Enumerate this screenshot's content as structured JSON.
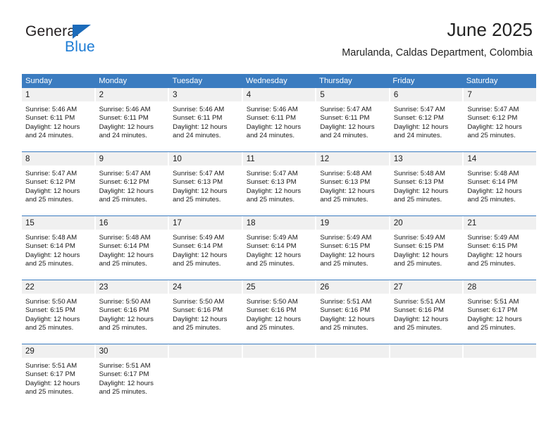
{
  "brand": {
    "name_part1": "General",
    "name_part2": "Blue",
    "triangle_icon": "blue-triangle-icon",
    "color_dark": "#231f20",
    "color_blue": "#1c7bd4"
  },
  "header": {
    "title": "June 2025",
    "subtitle": "Marulanda, Caldas Department, Colombia"
  },
  "theme": {
    "header_bar": "#3b7cc0",
    "day_band": "#f0f0f0",
    "text": "#1a1a1a"
  },
  "weekdays": [
    "Sunday",
    "Monday",
    "Tuesday",
    "Wednesday",
    "Thursday",
    "Friday",
    "Saturday"
  ],
  "weeks": [
    [
      {
        "day": "1",
        "sunrise": "Sunrise: 5:46 AM",
        "sunset": "Sunset: 6:11 PM",
        "daylight1": "Daylight: 12 hours",
        "daylight2": "and 24 minutes."
      },
      {
        "day": "2",
        "sunrise": "Sunrise: 5:46 AM",
        "sunset": "Sunset: 6:11 PM",
        "daylight1": "Daylight: 12 hours",
        "daylight2": "and 24 minutes."
      },
      {
        "day": "3",
        "sunrise": "Sunrise: 5:46 AM",
        "sunset": "Sunset: 6:11 PM",
        "daylight1": "Daylight: 12 hours",
        "daylight2": "and 24 minutes."
      },
      {
        "day": "4",
        "sunrise": "Sunrise: 5:46 AM",
        "sunset": "Sunset: 6:11 PM",
        "daylight1": "Daylight: 12 hours",
        "daylight2": "and 24 minutes."
      },
      {
        "day": "5",
        "sunrise": "Sunrise: 5:47 AM",
        "sunset": "Sunset: 6:11 PM",
        "daylight1": "Daylight: 12 hours",
        "daylight2": "and 24 minutes."
      },
      {
        "day": "6",
        "sunrise": "Sunrise: 5:47 AM",
        "sunset": "Sunset: 6:12 PM",
        "daylight1": "Daylight: 12 hours",
        "daylight2": "and 24 minutes."
      },
      {
        "day": "7",
        "sunrise": "Sunrise: 5:47 AM",
        "sunset": "Sunset: 6:12 PM",
        "daylight1": "Daylight: 12 hours",
        "daylight2": "and 25 minutes."
      }
    ],
    [
      {
        "day": "8",
        "sunrise": "Sunrise: 5:47 AM",
        "sunset": "Sunset: 6:12 PM",
        "daylight1": "Daylight: 12 hours",
        "daylight2": "and 25 minutes."
      },
      {
        "day": "9",
        "sunrise": "Sunrise: 5:47 AM",
        "sunset": "Sunset: 6:12 PM",
        "daylight1": "Daylight: 12 hours",
        "daylight2": "and 25 minutes."
      },
      {
        "day": "10",
        "sunrise": "Sunrise: 5:47 AM",
        "sunset": "Sunset: 6:13 PM",
        "daylight1": "Daylight: 12 hours",
        "daylight2": "and 25 minutes."
      },
      {
        "day": "11",
        "sunrise": "Sunrise: 5:47 AM",
        "sunset": "Sunset: 6:13 PM",
        "daylight1": "Daylight: 12 hours",
        "daylight2": "and 25 minutes."
      },
      {
        "day": "12",
        "sunrise": "Sunrise: 5:48 AM",
        "sunset": "Sunset: 6:13 PM",
        "daylight1": "Daylight: 12 hours",
        "daylight2": "and 25 minutes."
      },
      {
        "day": "13",
        "sunrise": "Sunrise: 5:48 AM",
        "sunset": "Sunset: 6:13 PM",
        "daylight1": "Daylight: 12 hours",
        "daylight2": "and 25 minutes."
      },
      {
        "day": "14",
        "sunrise": "Sunrise: 5:48 AM",
        "sunset": "Sunset: 6:14 PM",
        "daylight1": "Daylight: 12 hours",
        "daylight2": "and 25 minutes."
      }
    ],
    [
      {
        "day": "15",
        "sunrise": "Sunrise: 5:48 AM",
        "sunset": "Sunset: 6:14 PM",
        "daylight1": "Daylight: 12 hours",
        "daylight2": "and 25 minutes."
      },
      {
        "day": "16",
        "sunrise": "Sunrise: 5:48 AM",
        "sunset": "Sunset: 6:14 PM",
        "daylight1": "Daylight: 12 hours",
        "daylight2": "and 25 minutes."
      },
      {
        "day": "17",
        "sunrise": "Sunrise: 5:49 AM",
        "sunset": "Sunset: 6:14 PM",
        "daylight1": "Daylight: 12 hours",
        "daylight2": "and 25 minutes."
      },
      {
        "day": "18",
        "sunrise": "Sunrise: 5:49 AM",
        "sunset": "Sunset: 6:14 PM",
        "daylight1": "Daylight: 12 hours",
        "daylight2": "and 25 minutes."
      },
      {
        "day": "19",
        "sunrise": "Sunrise: 5:49 AM",
        "sunset": "Sunset: 6:15 PM",
        "daylight1": "Daylight: 12 hours",
        "daylight2": "and 25 minutes."
      },
      {
        "day": "20",
        "sunrise": "Sunrise: 5:49 AM",
        "sunset": "Sunset: 6:15 PM",
        "daylight1": "Daylight: 12 hours",
        "daylight2": "and 25 minutes."
      },
      {
        "day": "21",
        "sunrise": "Sunrise: 5:49 AM",
        "sunset": "Sunset: 6:15 PM",
        "daylight1": "Daylight: 12 hours",
        "daylight2": "and 25 minutes."
      }
    ],
    [
      {
        "day": "22",
        "sunrise": "Sunrise: 5:50 AM",
        "sunset": "Sunset: 6:15 PM",
        "daylight1": "Daylight: 12 hours",
        "daylight2": "and 25 minutes."
      },
      {
        "day": "23",
        "sunrise": "Sunrise: 5:50 AM",
        "sunset": "Sunset: 6:16 PM",
        "daylight1": "Daylight: 12 hours",
        "daylight2": "and 25 minutes."
      },
      {
        "day": "24",
        "sunrise": "Sunrise: 5:50 AM",
        "sunset": "Sunset: 6:16 PM",
        "daylight1": "Daylight: 12 hours",
        "daylight2": "and 25 minutes."
      },
      {
        "day": "25",
        "sunrise": "Sunrise: 5:50 AM",
        "sunset": "Sunset: 6:16 PM",
        "daylight1": "Daylight: 12 hours",
        "daylight2": "and 25 minutes."
      },
      {
        "day": "26",
        "sunrise": "Sunrise: 5:51 AM",
        "sunset": "Sunset: 6:16 PM",
        "daylight1": "Daylight: 12 hours",
        "daylight2": "and 25 minutes."
      },
      {
        "day": "27",
        "sunrise": "Sunrise: 5:51 AM",
        "sunset": "Sunset: 6:16 PM",
        "daylight1": "Daylight: 12 hours",
        "daylight2": "and 25 minutes."
      },
      {
        "day": "28",
        "sunrise": "Sunrise: 5:51 AM",
        "sunset": "Sunset: 6:17 PM",
        "daylight1": "Daylight: 12 hours",
        "daylight2": "and 25 minutes."
      }
    ],
    [
      {
        "day": "29",
        "sunrise": "Sunrise: 5:51 AM",
        "sunset": "Sunset: 6:17 PM",
        "daylight1": "Daylight: 12 hours",
        "daylight2": "and 25 minutes."
      },
      {
        "day": "30",
        "sunrise": "Sunrise: 5:51 AM",
        "sunset": "Sunset: 6:17 PM",
        "daylight1": "Daylight: 12 hours",
        "daylight2": "and 25 minutes."
      },
      {
        "day": "",
        "sunrise": "",
        "sunset": "",
        "daylight1": "",
        "daylight2": ""
      },
      {
        "day": "",
        "sunrise": "",
        "sunset": "",
        "daylight1": "",
        "daylight2": ""
      },
      {
        "day": "",
        "sunrise": "",
        "sunset": "",
        "daylight1": "",
        "daylight2": ""
      },
      {
        "day": "",
        "sunrise": "",
        "sunset": "",
        "daylight1": "",
        "daylight2": ""
      },
      {
        "day": "",
        "sunrise": "",
        "sunset": "",
        "daylight1": "",
        "daylight2": ""
      }
    ]
  ]
}
